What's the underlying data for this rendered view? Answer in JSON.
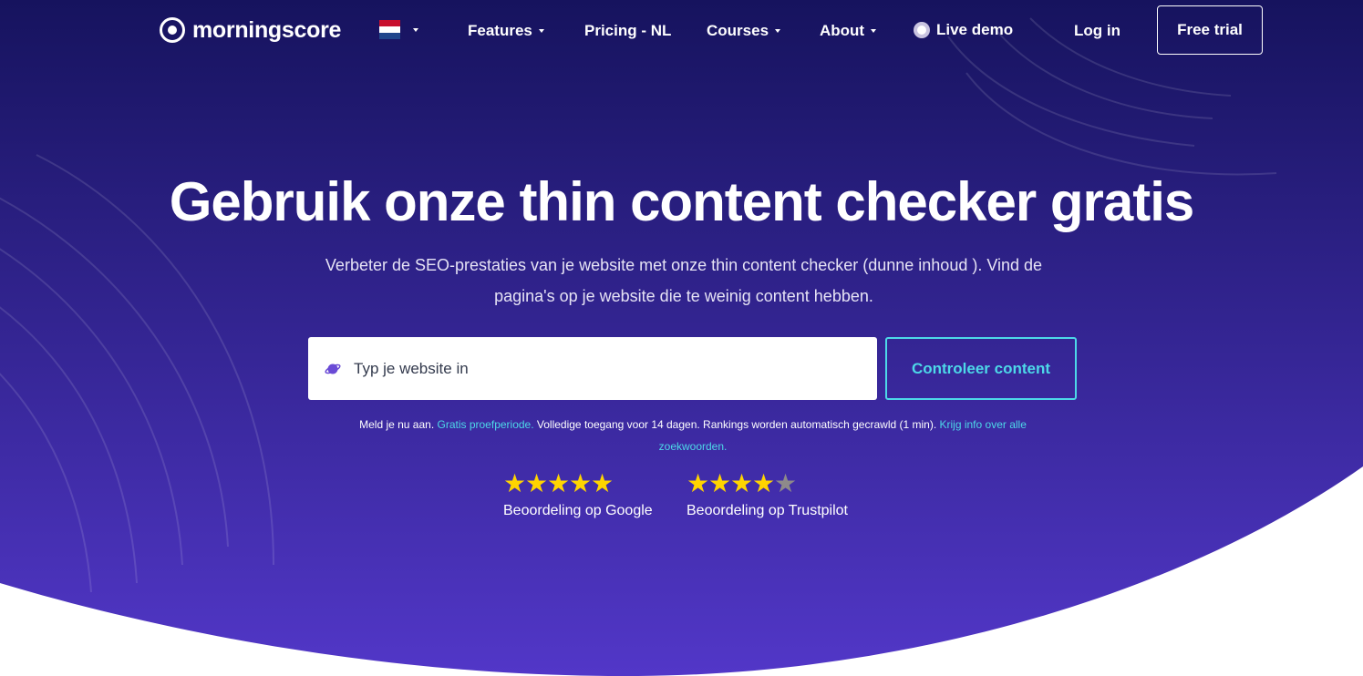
{
  "colors": {
    "hero_top": "#16135e",
    "hero_bottom": "#5237c8",
    "accent": "#4dd8e8",
    "star": "#ffd400",
    "star_empty": "#8e8a8a"
  },
  "header": {
    "logo_text": "morningscore",
    "language_flag": "NL",
    "nav": [
      {
        "label": "Features",
        "has_dropdown": true
      },
      {
        "label": "Pricing - NL",
        "has_dropdown": false
      },
      {
        "label": "Courses",
        "has_dropdown": true
      },
      {
        "label": "About",
        "has_dropdown": true
      },
      {
        "label": "Live demo",
        "has_dropdown": false,
        "icon": "live-dot-icon"
      }
    ],
    "login_label": "Log in",
    "trial_label": "Free trial"
  },
  "hero": {
    "title": "Gebruik onze thin content checker gratis",
    "subtitle": "Verbeter de SEO-prestaties van je website met onze thin content checker (dunne inhoud ). Vind de pagina's op je website die te weinig content hebben.",
    "search": {
      "placeholder": "Typ je website in",
      "value": "",
      "icon": "planet-icon"
    },
    "check_button": "Controleer content",
    "signup_note": {
      "prefix": "Meld je nu aan. ",
      "link1": "Gratis proefperiode.",
      "middle": " Volledige toegang voor 14 dagen. Rankings worden automatisch gecrawld (1 min). ",
      "link2": "Krijg info over alle zoekwoorden."
    }
  },
  "ratings": [
    {
      "label": "Beoordeling op Google",
      "stars": 5,
      "max": 5
    },
    {
      "label": "Beoordeling op Trustpilot",
      "stars": 4,
      "max": 5
    }
  ]
}
